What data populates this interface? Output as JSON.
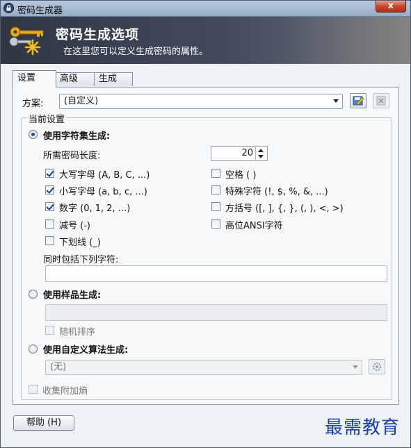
{
  "window": {
    "title": "密码生成器",
    "close_label": "x"
  },
  "banner": {
    "title": "密码生成选项",
    "subtitle": "在这里您可以定义生成密码的属性。"
  },
  "tabs": [
    {
      "label": "设置",
      "active": true
    },
    {
      "label": "高级",
      "active": false
    },
    {
      "label": "生成",
      "active": false
    }
  ],
  "scheme": {
    "label": "方案:",
    "value": "(自定义)"
  },
  "current_settings": {
    "legend": "当前设置",
    "charset_option": "使用字符集生成:",
    "length_label": "所需密码长度:",
    "length_value": "20",
    "checkboxes": [
      {
        "label": "大写字母 (A, B, C, ...)",
        "checked": true
      },
      {
        "label": "小写字母 (a, b, c, ...)",
        "checked": true
      },
      {
        "label": "数字 (0, 1, 2, ...)",
        "checked": true
      },
      {
        "label": "减号 (-)",
        "checked": false
      },
      {
        "label": "下划线 (_)",
        "checked": false
      },
      {
        "label": "空格 ( )",
        "checked": false
      },
      {
        "label": "特殊字符 (!, $, %, &, ...)",
        "checked": false
      },
      {
        "label": "方括号 ([, ], {, }, (, ), <, >)",
        "checked": false
      },
      {
        "label": "高位ANSI字符",
        "checked": false
      }
    ],
    "include_also_label": "同时包括下列字符:",
    "pattern_option": "使用样品生成:",
    "random_order_label": "随机排序",
    "custom_algo_option": "使用自定义算法生成:",
    "custom_algo_value": "(无)",
    "collect_entropy_label": "收集附加熵"
  },
  "footer": {
    "help_label": "帮助 (H)",
    "watermark": "最需教育"
  }
}
